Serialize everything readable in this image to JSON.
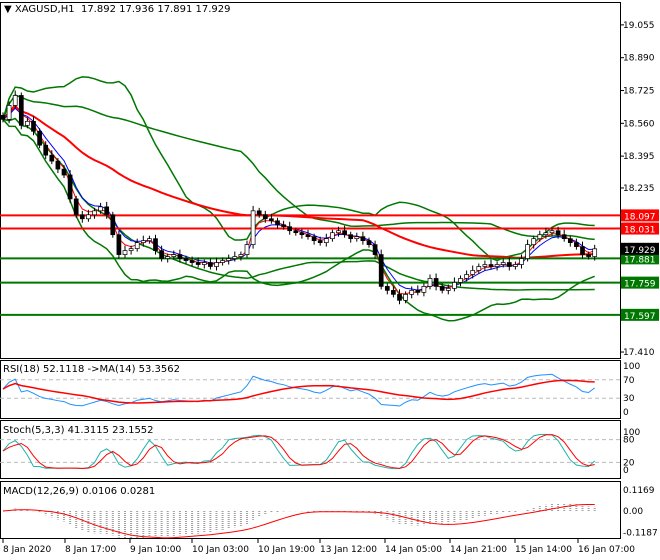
{
  "header": {
    "symbol_timeframe": "XAGUSD,H1",
    "open": "17.892",
    "high": "17.936",
    "low": "17.891",
    "close": "17.929"
  },
  "indicators": {
    "rsi_label": "RSI(18) 52.1118  ->MA(14) 53.3562",
    "stoch_label": "Stoch(5,3,3) 41.3115 23.1552",
    "macd_label": "MACD(12,26,9) 0.0106 0.0281"
  },
  "colors": {
    "bull": "#ffffff",
    "bear": "#000000",
    "bands": "#007700",
    "slow_ma": "#ff0000",
    "fast_ma": "#0000ff",
    "resistance": "#ff0000",
    "support": "#007700",
    "rsi": "#1e90ff",
    "stoch_main": "#20b2aa",
    "stoch_signal": "#ff0000",
    "macd_hist": "#a0a0a0"
  },
  "chart_data": {
    "type": "candlestick",
    "price_axis_ticks": [
      "19.055",
      "18.890",
      "18.725",
      "18.560",
      "18.395",
      "18.235",
      "17.410"
    ],
    "price_range": [
      17.38,
      19.17
    ],
    "time_labels": [
      "8 Jan 2020",
      "8 Jan 17:00",
      "9 Jan 10:00",
      "10 Jan 03:00",
      "10 Jan 19:00",
      "13 Jan 12:00",
      "14 Jan 05:00",
      "14 Jan 21:00",
      "15 Jan 14:00",
      "16 Jan 07:00"
    ],
    "closes": [
      18.58,
      18.65,
      18.7,
      18.55,
      18.57,
      18.52,
      18.45,
      18.4,
      18.37,
      18.33,
      18.3,
      18.18,
      18.1,
      18.08,
      18.1,
      18.12,
      18.14,
      18.1,
      18.0,
      17.9,
      17.92,
      17.93,
      17.96,
      17.97,
      17.98,
      17.92,
      17.88,
      17.89,
      17.9,
      17.88,
      17.87,
      17.86,
      17.85,
      17.86,
      17.84,
      17.86,
      17.87,
      17.88,
      17.89,
      17.9,
      17.95,
      18.12,
      18.1,
      18.08,
      18.07,
      18.05,
      18.04,
      18.02,
      18.01,
      18.0,
      17.99,
      17.97,
      17.96,
      17.98,
      18.01,
      18.02,
      18.0,
      17.98,
      17.99,
      17.97,
      17.95,
      17.9,
      17.74,
      17.72,
      17.7,
      17.67,
      17.7,
      17.72,
      17.71,
      17.74,
      17.78,
      17.74,
      17.72,
      17.73,
      17.76,
      17.78,
      17.8,
      17.82,
      17.84,
      17.85,
      17.84,
      17.85,
      17.86,
      17.84,
      17.85,
      17.88,
      17.95,
      17.98,
      18.0,
      18.01,
      18.02,
      18.0,
      17.98,
      17.96,
      17.94,
      17.9,
      17.89,
      17.929
    ],
    "levels": [
      {
        "price": "18.097",
        "kind": "resistance"
      },
      {
        "price": "18.031",
        "kind": "resistance"
      },
      {
        "price": "17.881",
        "kind": "support"
      },
      {
        "price": "17.759",
        "kind": "support"
      },
      {
        "price": "17.597",
        "kind": "support"
      }
    ],
    "current_price": "17.929",
    "rsi_axis": [
      "100",
      "70",
      "30",
      "0"
    ],
    "stoch_axis": [
      "100",
      "80",
      "20",
      "0"
    ],
    "macd_axis": [
      "0.1169",
      "0.00",
      "-0.1187"
    ]
  }
}
